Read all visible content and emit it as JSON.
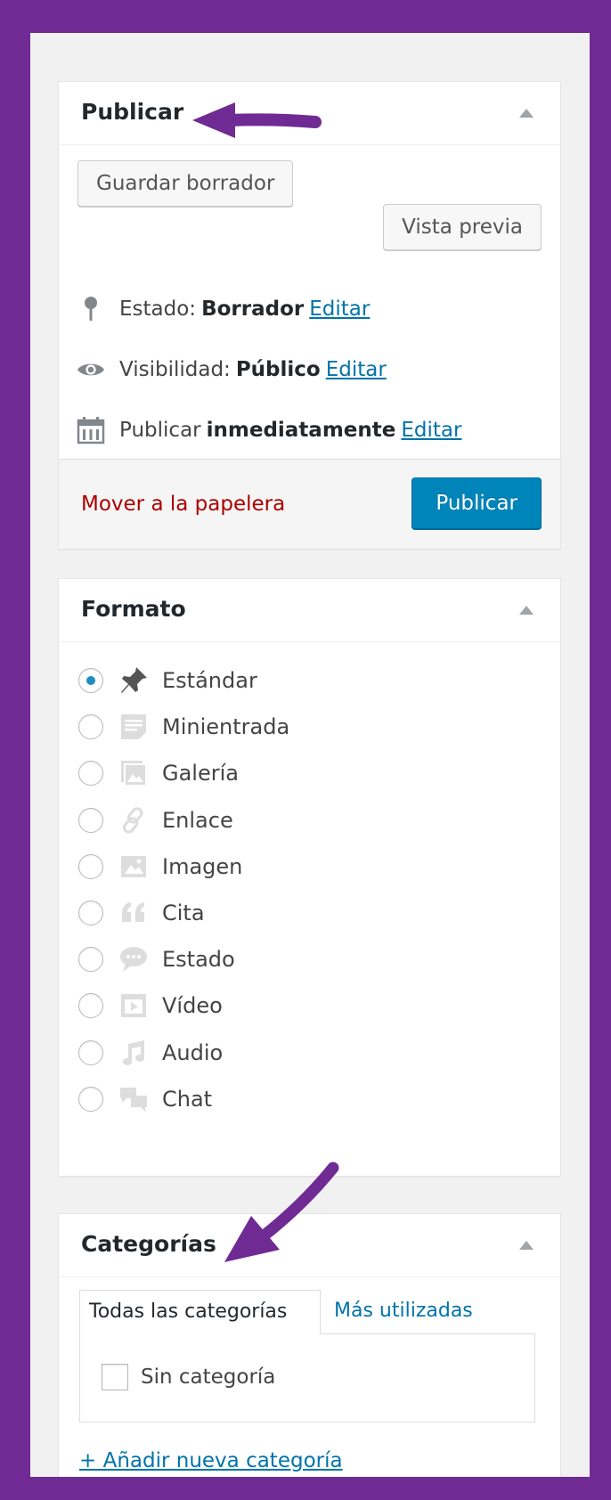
{
  "publish_box": {
    "title": "Publicar",
    "save_draft_label": "Guardar borrador",
    "preview_label": "Vista previa",
    "status_label": "Estado:",
    "status_value": "Borrador",
    "visibility_label": "Visibilidad:",
    "visibility_value": "Público",
    "schedule_label": "Publicar",
    "schedule_value": "inmediatamente",
    "edit_label": "Editar",
    "trash_label": "Mover a la papelera",
    "publish_button_label": "Publicar"
  },
  "format_box": {
    "title": "Formato",
    "options": [
      {
        "label": "Estándar",
        "icon": "pin-icon",
        "checked": true
      },
      {
        "label": "Minientrada",
        "icon": "aside-icon",
        "checked": false
      },
      {
        "label": "Galería",
        "icon": "gallery-icon",
        "checked": false
      },
      {
        "label": "Enlace",
        "icon": "link-icon",
        "checked": false
      },
      {
        "label": "Imagen",
        "icon": "image-icon",
        "checked": false
      },
      {
        "label": "Cita",
        "icon": "quote-icon",
        "checked": false
      },
      {
        "label": "Estado",
        "icon": "status-icon",
        "checked": false
      },
      {
        "label": "Vídeo",
        "icon": "video-icon",
        "checked": false
      },
      {
        "label": "Audio",
        "icon": "audio-icon",
        "checked": false
      },
      {
        "label": "Chat",
        "icon": "chat-icon",
        "checked": false
      }
    ]
  },
  "categories_box": {
    "title": "Categorías",
    "tab_all_label": "Todas las categorías",
    "tab_popular_label": "Más utilizadas",
    "category_label": "Sin categoría",
    "add_new_label": "+ Añadir nueva categoría"
  },
  "colors": {
    "frame": "#6f2b93",
    "primary_button": "#0085ba",
    "link": "#0073aa",
    "trash": "#aa0000"
  }
}
